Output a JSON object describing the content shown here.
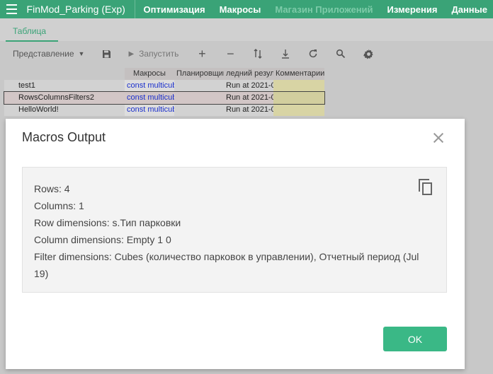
{
  "topbar": {
    "app_title": "FinMod_Parking (Exp)",
    "nav": [
      {
        "label": "Оптимизация"
      },
      {
        "label": "Макросы"
      },
      {
        "label": "Магазин Приложений"
      },
      {
        "label": "Измерения"
      },
      {
        "label": "Данные"
      }
    ]
  },
  "tabs": [
    {
      "label": "Таблица"
    }
  ],
  "toolbar": {
    "view_label": "Представление",
    "run_label": "Запустить"
  },
  "grid": {
    "columns": [
      "Макросы",
      "Планировщик",
      "ледний резуль",
      "Комментарии"
    ],
    "rows": [
      {
        "name": "test1",
        "macro": "const multicub",
        "scheduler": "",
        "last_result": "Run at 2021-0",
        "comment": ""
      },
      {
        "name": "RowsColumnsFilters2",
        "macro": "const multicub",
        "scheduler": "",
        "last_result": "Run at 2021-0",
        "comment": ""
      },
      {
        "name": "HelloWorld!",
        "macro": "const multicub",
        "scheduler": "",
        "last_result": "Run at 2021-0",
        "comment": ""
      }
    ]
  },
  "modal": {
    "title": "Macros Output",
    "output_lines": [
      "Rows: 4",
      "Columns: 1",
      "Row dimensions: s.Тип парковки",
      "Column dimensions: Empty 1 0",
      "Filter dimensions: Cubes (количество парковок в управлении), Отчетный период (Jul 19)"
    ],
    "ok_label": "OK"
  },
  "colors": {
    "accent": "#3aa377",
    "ok_button": "#3ab886",
    "link": "#1a2fcc"
  }
}
